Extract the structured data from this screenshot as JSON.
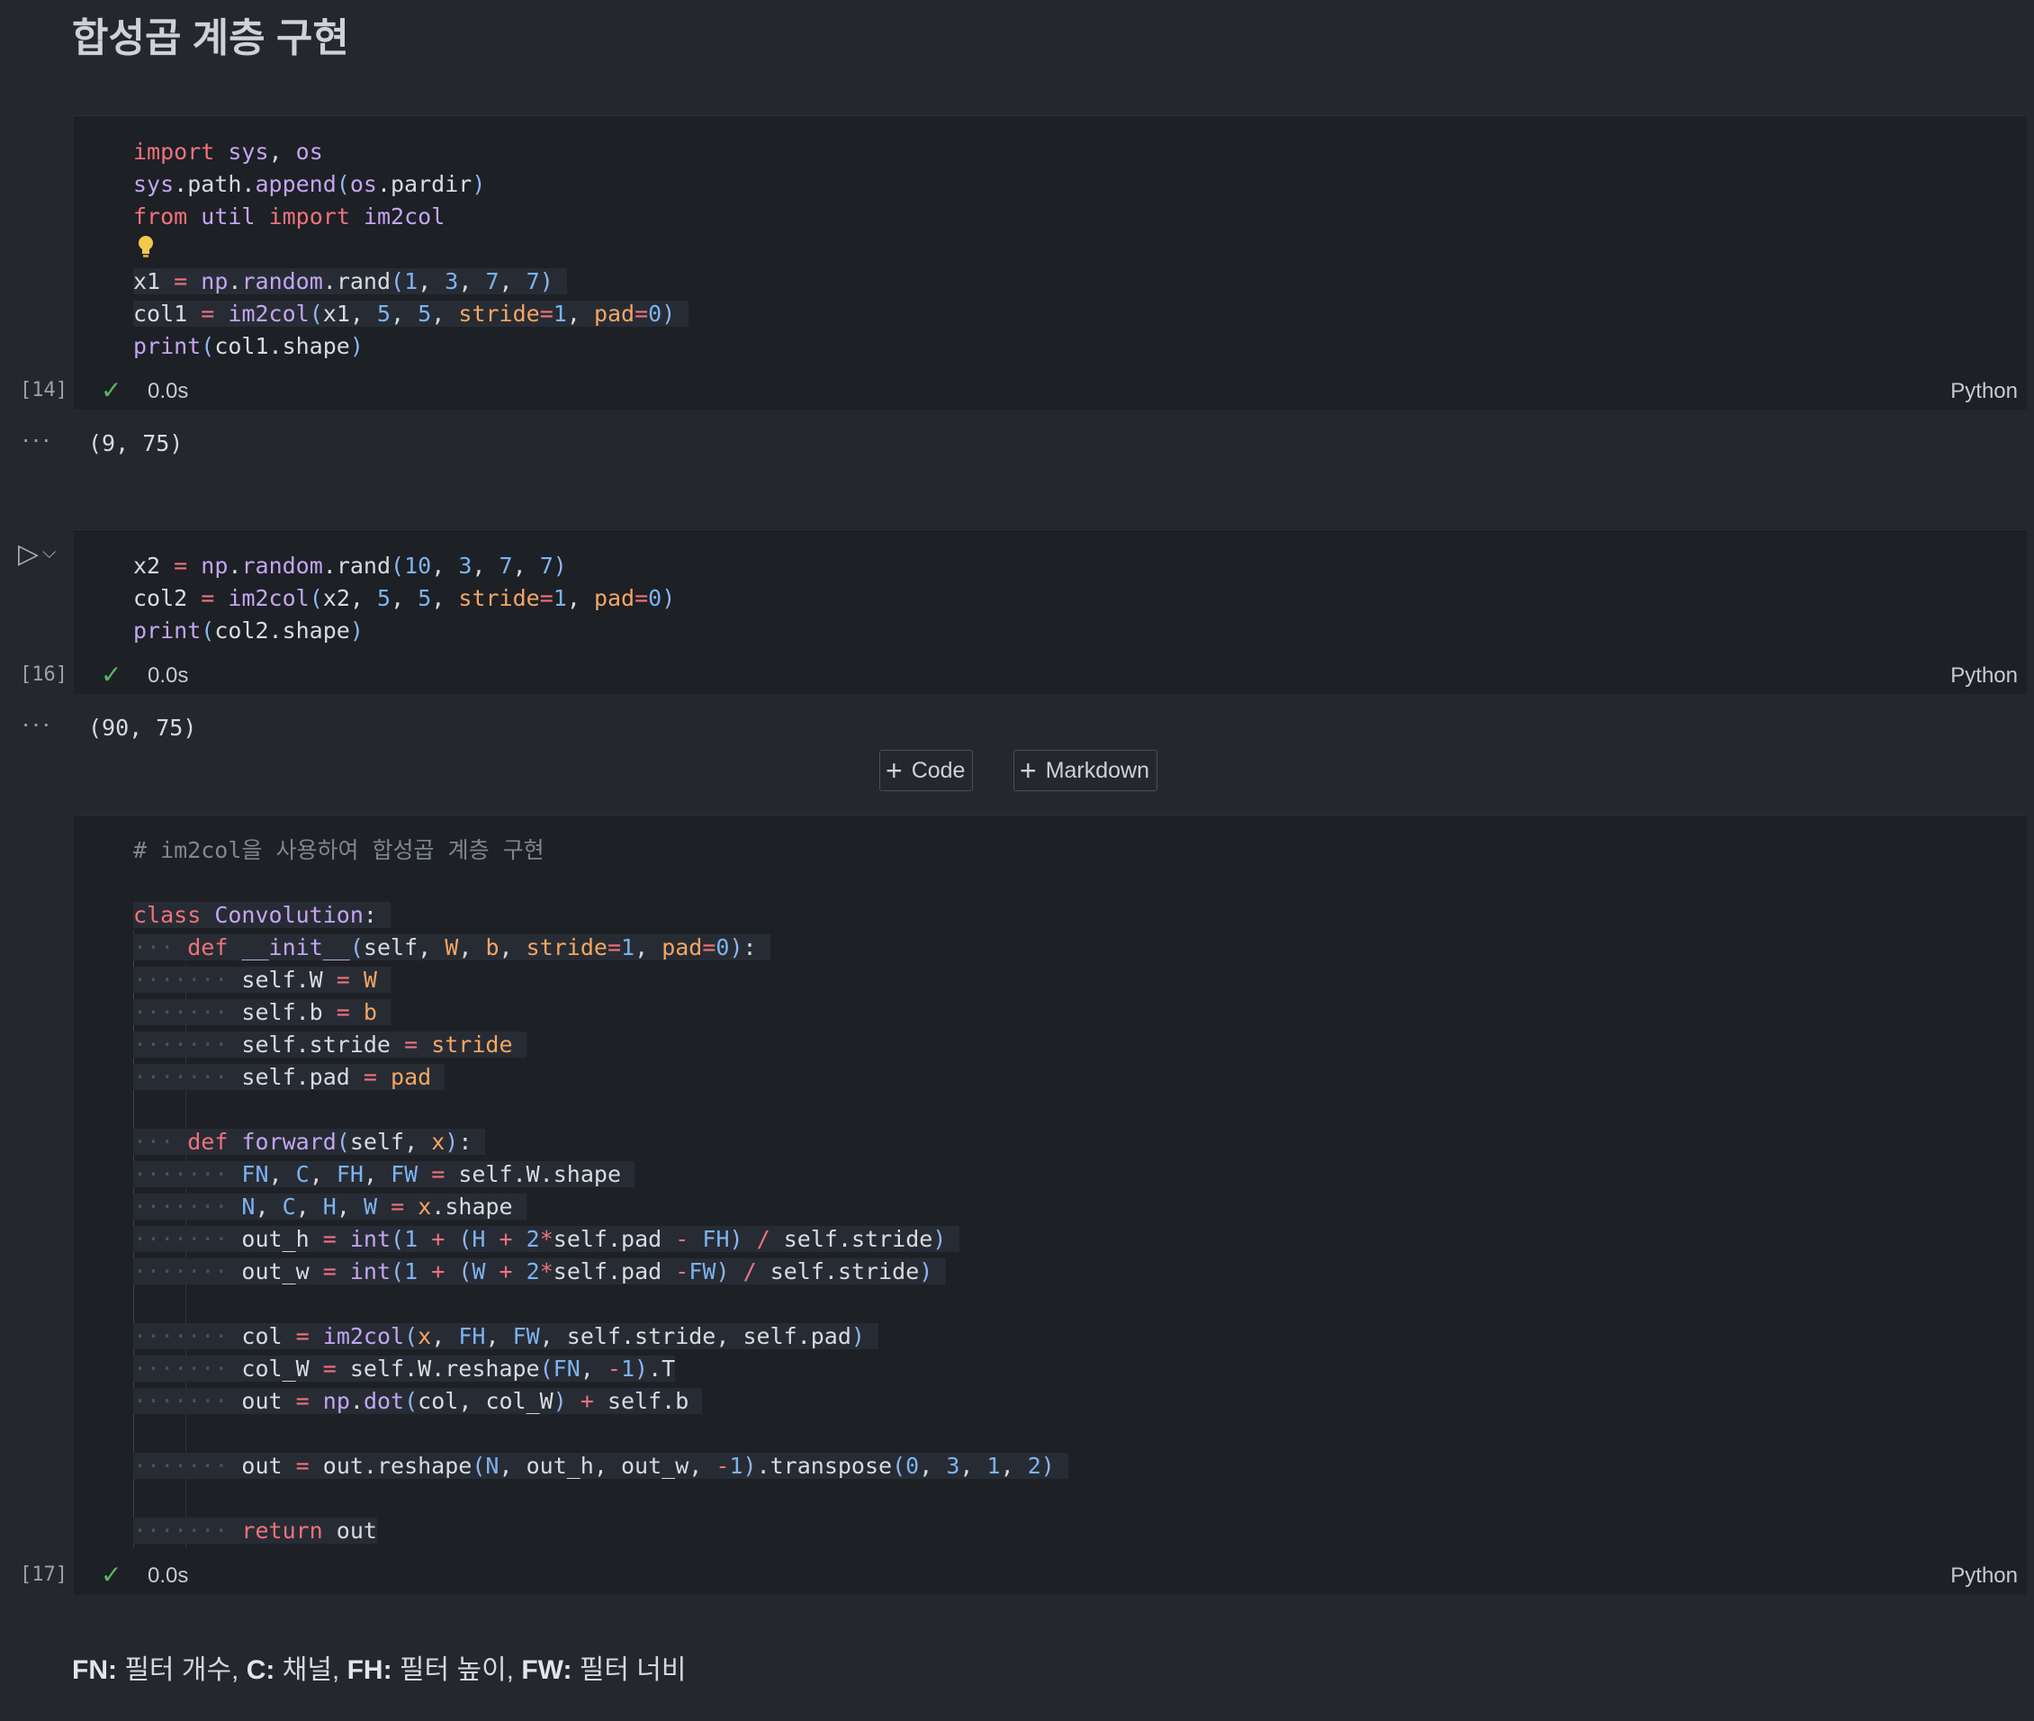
{
  "heading": "합성곱 계층 구현",
  "cells": [
    {
      "count": "[14]",
      "time": "0.0s",
      "lang": "Python",
      "output": "(9, 75)"
    },
    {
      "count": "[16]",
      "time": "0.0s",
      "lang": "Python",
      "output": "(90, 75)"
    },
    {
      "count": "[17]",
      "time": "0.0s",
      "lang": "Python"
    }
  ],
  "buttons": {
    "code": "Code",
    "markdown": "Markdown"
  },
  "footer": {
    "fn_key": "FN:",
    "fn_val": " 필터 개수, ",
    "c_key": "C:",
    "c_val": " 채널, ",
    "fh_key": "FH:",
    "fh_val": " 필터 높이, ",
    "fw_key": "FW:",
    "fw_val": " 필터 너비"
  },
  "icons": {
    "status": "check-icon",
    "run": "play-icon",
    "add": "plus-icon",
    "hint": "lightbulb-icon",
    "output_menu": "ellipsis-icon"
  },
  "colors": {
    "keyword": "#f0727b",
    "function": "#c4a5f2",
    "number": "#7cb3f2",
    "param": "#f5a663",
    "success": "#58b85c"
  }
}
